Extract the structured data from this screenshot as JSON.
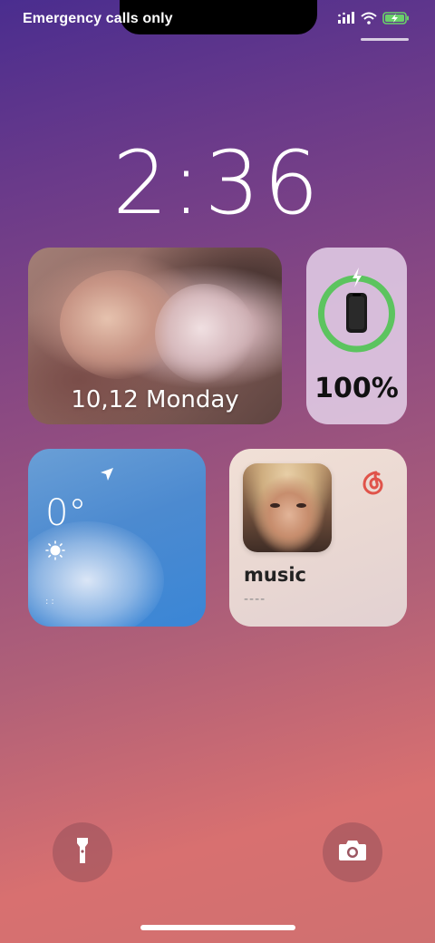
{
  "status_bar": {
    "carrier_text": "Emergency calls only",
    "icons": [
      "signal-icon",
      "wifi-icon",
      "battery-charging-icon"
    ]
  },
  "lock_screen": {
    "time": "2:36",
    "accent_colors": {
      "battery_ring": "#5cc45f",
      "music_brand": "#e0534a"
    }
  },
  "widgets": {
    "photo": {
      "date_label": "10,12 Monday"
    },
    "battery": {
      "percent_label": "100%",
      "level": 1.0,
      "icons": [
        "charging-bolt-icon",
        "phone-icon"
      ]
    },
    "weather": {
      "temperature": "0°",
      "icons": [
        "location-arrow-icon",
        "sun-icon"
      ],
      "footer": "::"
    },
    "music": {
      "title": "music",
      "artist": "----",
      "icons": [
        "netease-music-icon"
      ]
    }
  },
  "bottom_controls": {
    "left": "flashlight-icon",
    "right": "camera-icon"
  }
}
